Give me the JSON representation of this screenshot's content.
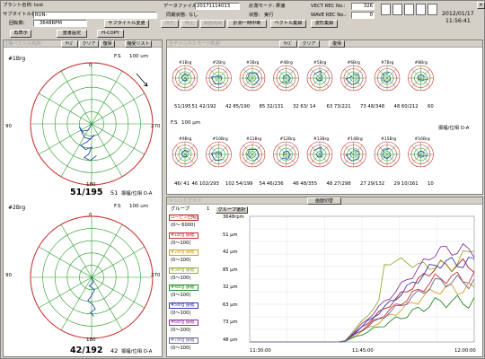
{
  "header": {
    "plant_label": "プラント名称:",
    "plant_value": "test",
    "subtitle_label": "サブタイトル名:",
    "subtitle_value": "RUN-",
    "datafile_label": "データファイル名:",
    "datafile_value": "20171114013",
    "sync_label": "同期状態:",
    "sync_value": "なし",
    "mode_label": "計測モード:",
    "mode_value": "昇速",
    "state_label": "状態:",
    "state_value": "実行",
    "vect_label": "VECT REC No.:",
    "vect_value": "326",
    "wave_label": "WAVE REC No.:",
    "wave_value": "0",
    "rpm_label": "回転数:",
    "rpm_value": "3648RPM",
    "date": "2012/01/17",
    "time": "11:56:41"
  },
  "toolbar": {
    "btn_subtitle": "サブタイトル変更",
    "btn_redisplay": "再表示",
    "btn_reset": "重書設定",
    "btn_hcopy": "H-COPY",
    "btn_resume": "録画再開",
    "btn_pause": "計測一時中断",
    "btn_vector": "ベクトル集録",
    "btn_wave": "波形集録",
    "btn_f1": "日付",
    "btn_f2": "停止"
  },
  "icons": [
    "icon-a",
    "icon-b",
    "icon-c",
    "icon-d",
    "icon-e"
  ],
  "left_panel": {
    "title": "1軸ベクトル軌跡",
    "btn_size": "ｻｲｽﾞ",
    "btn_clear": "クリア",
    "btn_restore": "復帰",
    "btn_list": "軸受リスト"
  },
  "polar1": {
    "name": "#1Brg",
    "fs": "F.S",
    "fs_value": "100 um",
    "a0": "0",
    "a90": "90",
    "a180": "180",
    "a270": "270",
    "reading": "51/195",
    "amp": "51",
    "unit": "振幅/位相 O-A"
  },
  "polar2": {
    "name": "#2Brg",
    "fs": "F.S",
    "fs_value": "100 um",
    "a0": "0",
    "a90": "90",
    "a180": "180",
    "a270": "270",
    "reading": "42/192",
    "amp": "42",
    "unit": "振幅/位相 O-A"
  },
  "multi_panel": {
    "title": "全チャンネルモード軌跡",
    "btn_size": "ｻｲｽﾞ",
    "btn_clear": "クリア",
    "btn_restore": "復帰",
    "fs": "F.S",
    "fs_value": "100 μm",
    "unit": "振幅/位相 O-A",
    "row1": [
      {
        "name": "#1Brg",
        "label": "51/195"
      },
      {
        "name": "#2Brg",
        "label": "51 42/192"
      },
      {
        "name": "#3Brg",
        "label": "42 85/190"
      },
      {
        "name": "#4Brg",
        "label": "85 32/131"
      },
      {
        "name": "#5Brg",
        "label": "32 63/ 14"
      },
      {
        "name": "#6Brg",
        "label": "63 73/221"
      },
      {
        "name": "#7Brg",
        "label": "73 48/348"
      },
      {
        "name": "#8Brg",
        "label": "48 60/212"
      },
      {
        "name": "",
        "label": "60"
      }
    ],
    "row2": [
      {
        "name": "#9Brg",
        "label": "46/ 41"
      },
      {
        "name": "#10Brg",
        "label": "46 102/293"
      },
      {
        "name": "#11Brg",
        "label": "102 54/199"
      },
      {
        "name": "#12Brg",
        "label": "54 46/236"
      },
      {
        "name": "#13Brg",
        "label": "46 48/355"
      },
      {
        "name": "#14Brg",
        "label": "48 27/298"
      },
      {
        "name": "#15Brg",
        "label": "27 29/132"
      },
      {
        "name": "#16Brg",
        "label": "29 10/161"
      },
      {
        "name": "",
        "label": "10"
      }
    ]
  },
  "trend_panel": {
    "title": "トレンドグラフ",
    "btn_switch": "画面切替",
    "group_label": "グループ",
    "group_value": "1",
    "btn_group": "グループ選択",
    "x_ticks": [
      "11:30:00",
      "11:45:00",
      "12:00:00"
    ],
    "legend": [
      {
        "name": "ローピン回転計",
        "range": "(0〜 6000)",
        "value": "3648rpm",
        "color": "#b22222"
      },
      {
        "name": "#1Brg 振幅",
        "range": "(0〜100)",
        "value": "51 μm",
        "color": "#cc3333"
      },
      {
        "name": "#2Brg 振幅",
        "range": "(0〜100)",
        "value": "42 μm",
        "color": "#d4a020"
      },
      {
        "name": "#3Brg 振幅",
        "range": "(0〜100)",
        "value": "85 μm",
        "color": "#99aa33"
      },
      {
        "name": "#4Brg 振幅",
        "range": "(0〜100)",
        "value": "32 μm",
        "color": "#2a8a2a"
      },
      {
        "name": "#5Brg 振幅",
        "range": "(0〜100)",
        "value": "63 μm",
        "color": "#3a3ab0"
      },
      {
        "name": "#6Brg 振幅",
        "range": "(0〜100)",
        "value": "73 μm",
        "color": "#8a3a9a"
      },
      {
        "name": "#7Brg 振幅",
        "range": "(0〜100)",
        "value": "48 μm",
        "color": "#6a6a9a"
      }
    ]
  },
  "colors": {
    "rings": "#cc3333",
    "grid": "#2a9a2a",
    "trace": "#1a3aa0"
  },
  "chart_data": {
    "type": "line",
    "x": [
      "11:30:00",
      "11:45:00",
      "12:00:00"
    ],
    "series": [
      {
        "name": "ローピン回転計",
        "color": "#b22222",
        "values": [
          0,
          0,
          3648
        ]
      },
      {
        "name": "#1Brg 振幅",
        "color": "#cc3333",
        "values": [
          0,
          0,
          51
        ]
      },
      {
        "name": "#2Brg 振幅",
        "color": "#d4a020",
        "values": [
          0,
          0,
          42
        ]
      },
      {
        "name": "#3Brg 振幅",
        "color": "#99aa33",
        "values": [
          0,
          0,
          85
        ]
      },
      {
        "name": "#4Brg 振幅",
        "color": "#2a8a2a",
        "values": [
          0,
          0,
          32
        ]
      },
      {
        "name": "#5Brg 振幅",
        "color": "#3a3ab0",
        "values": [
          0,
          0,
          63
        ]
      },
      {
        "name": "#6Brg 振幅",
        "color": "#8a3a9a",
        "values": [
          0,
          0,
          73
        ]
      },
      {
        "name": "#7Brg 振幅",
        "color": "#6a6a9a",
        "values": [
          0,
          0,
          48
        ]
      }
    ]
  }
}
